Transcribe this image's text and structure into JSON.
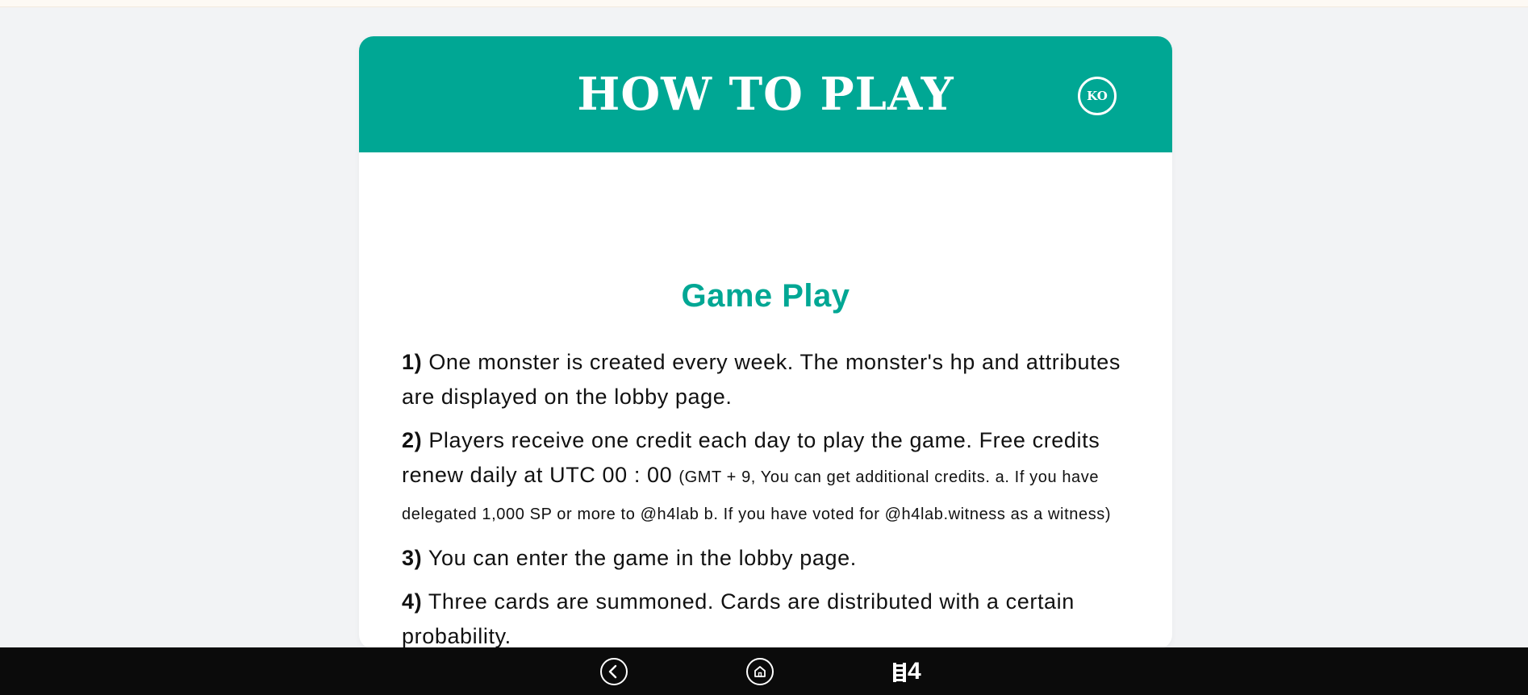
{
  "header": {
    "title": "HOW TO PLAY",
    "language_button": "KO"
  },
  "section": {
    "title": "Game Play"
  },
  "rules": [
    {
      "number": "1)",
      "text": "One monster is created every week. The monster's hp and attributes are displayed on the lobby page."
    },
    {
      "number": "2)",
      "text": "Players receive one credit each day to play the game. Free credits renew daily at UTC 00 : 00",
      "note": "(GMT + 9, You can get additional credits. a. If you have delegated 1,000 SP or more to @h4lab b. If you have voted for @h4lab.witness as a witness)"
    },
    {
      "number": "3)",
      "text": "You can enter the game in the lobby page."
    },
    {
      "number": "4)",
      "text": "Three cards are summoned. Cards are distributed with a certain probability."
    }
  ],
  "bottom_nav": {
    "back_icon": "chevron-left-icon",
    "home_icon": "home-icon",
    "logo_text": "4"
  },
  "colors": {
    "accent": "#00a794",
    "background": "#f2f3f5",
    "nav_background": "#0b0b0b"
  }
}
